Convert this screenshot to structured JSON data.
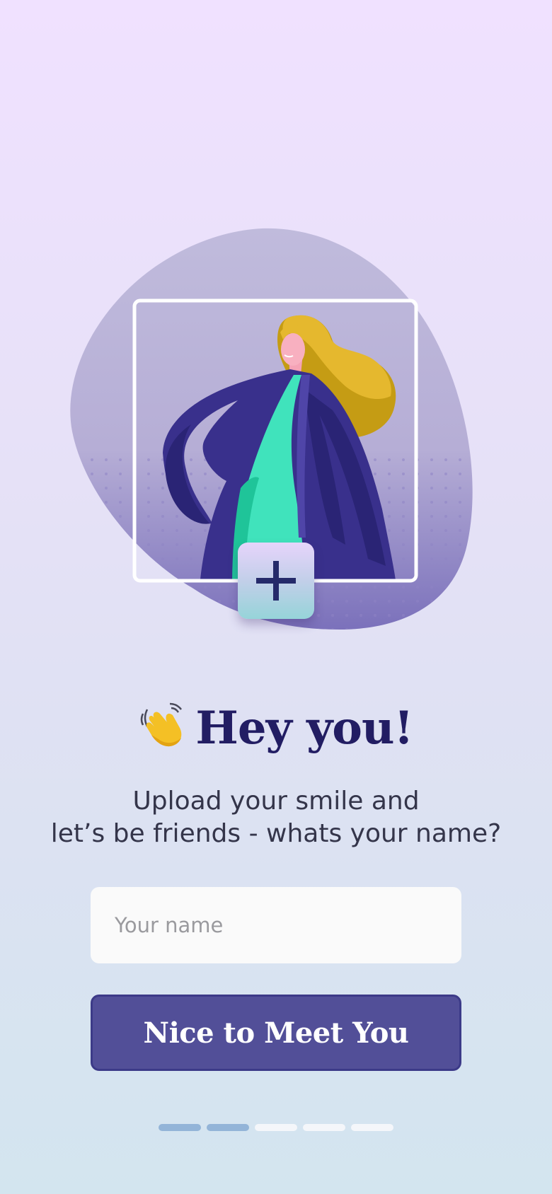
{
  "onboarding": {
    "headline": "Hey you!",
    "subtitle_line1": "Upload your smile and",
    "subtitle_line2": "let’s be friends - whats your name?",
    "name_input": {
      "value": "",
      "placeholder": "Your name"
    },
    "cta_label": "Nice to Meet You",
    "icons": {
      "greeting": "waving-hand-icon",
      "add_photo": "plus-icon"
    },
    "pager": {
      "total_steps": 5,
      "active_steps": 2
    }
  },
  "colors": {
    "headline": "#221d63",
    "button": "#524f98",
    "pager_active": "#93b4d8",
    "pager_inactive": "#f4f6fa"
  }
}
